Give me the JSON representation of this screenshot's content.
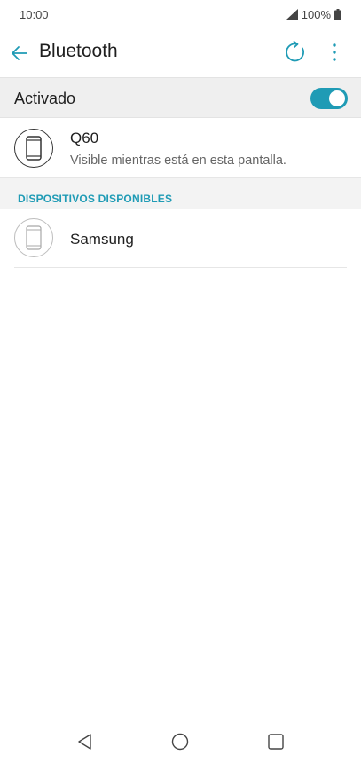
{
  "status_bar": {
    "time": "10:00",
    "battery": "100%"
  },
  "app_bar": {
    "title": "Bluetooth"
  },
  "toggle": {
    "label": "Activado",
    "state": "on"
  },
  "own_device": {
    "name": "Q60",
    "subtitle": "Visible mientras está en esta pantalla."
  },
  "available": {
    "header": "DISPOSITIVOS DISPONIBLES",
    "devices": [
      {
        "name": "Samsung"
      }
    ]
  },
  "colors": {
    "accent": "#1f9bb5"
  },
  "icons": {
    "back": "arrow-left-icon",
    "refresh": "refresh-icon",
    "menu": "more-vert-icon",
    "device": "phone-icon",
    "signal": "signal-icon",
    "battery": "battery-icon"
  }
}
